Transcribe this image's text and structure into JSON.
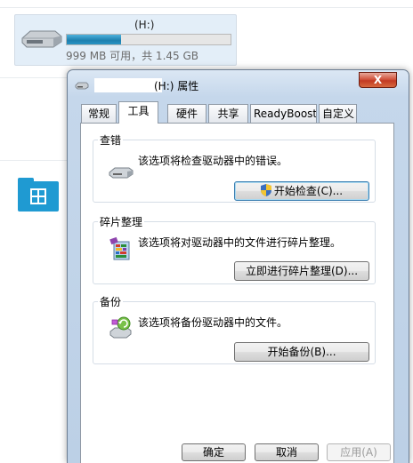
{
  "explorer": {
    "drive": {
      "name": "(H:)",
      "free_text": "999 MB 可用，共 1.45 GB",
      "used_fraction": 0.33,
      "icon": "usb-drive-icon"
    },
    "folder": {
      "icon": "library-folder-icon",
      "stray_text": "■"
    }
  },
  "dialog": {
    "title": "(H:) 属性",
    "close_label": "X",
    "title_icon": "drive-icon",
    "tabs": [
      {
        "label": "常规"
      },
      {
        "label": "工具"
      },
      {
        "label": "硬件"
      },
      {
        "label": "共享"
      },
      {
        "label": "ReadyBoost"
      },
      {
        "label": "自定义"
      }
    ],
    "active_tab": "工具",
    "sections": {
      "error_check": {
        "title": "查错",
        "description": "该选项将检查驱动器中的错误。",
        "button": "开始检查(C)...",
        "icon": "disk-check-icon",
        "button_icon": "uac-shield-icon"
      },
      "defrag": {
        "title": "碎片整理",
        "description": "该选项将对驱动器中的文件进行碎片整理。",
        "button": "立即进行碎片整理(D)...",
        "icon": "defrag-icon"
      },
      "backup": {
        "title": "备份",
        "description": "该选项将备份驱动器中的文件。",
        "button": "开始备份(B)...",
        "icon": "backup-icon"
      }
    },
    "footer": {
      "ok": "确定",
      "cancel": "取消",
      "apply": "应用(A)"
    }
  },
  "colors": {
    "usage_bar": "#2a94c4",
    "close_button": "#c23a22",
    "folder": "#1f9ad2",
    "dialog_frame": "#c5d7eb"
  }
}
